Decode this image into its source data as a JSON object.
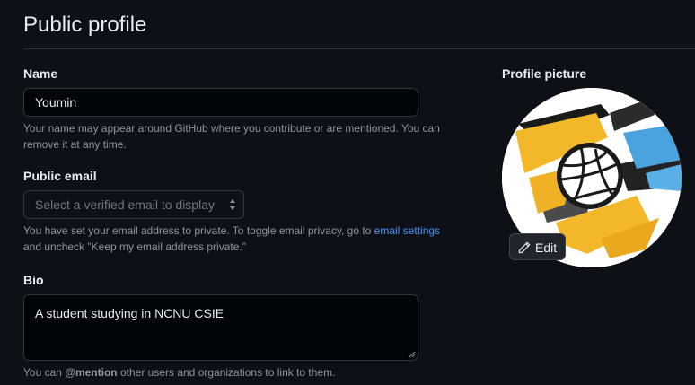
{
  "header": {
    "title": "Public profile"
  },
  "name_section": {
    "label": "Name",
    "value": "Youmin",
    "note_line1": "Your name may appear around GitHub where you contribute or are mentioned. You can",
    "note_line2": "remove it at any time."
  },
  "email_section": {
    "label": "Public email",
    "placeholder": "Select a verified email to display",
    "note_prefix": "You have set your email address to private. To toggle email privacy, go to ",
    "note_link": "email settings",
    "note_line2": "and uncheck \"Keep my email address private.\""
  },
  "bio_section": {
    "label": "Bio",
    "value": "A student studying in NCNU CSIE",
    "note_prefix": "You can ",
    "note_mention": "@mention",
    "note_suffix": " other users and organizations to link to them."
  },
  "profile_picture": {
    "label": "Profile picture",
    "edit_label": "Edit",
    "edit_icon": "pencil-icon",
    "image_subject": "volleyball-icon"
  },
  "colors": {
    "background": "#0d1117",
    "input_background": "#010409",
    "border": "#30363d",
    "text": "#e6edf3",
    "muted": "#8d96a0",
    "link": "#4493f8",
    "splash_yellow": "#f2b829",
    "splash_blue": "#4aa3df"
  }
}
